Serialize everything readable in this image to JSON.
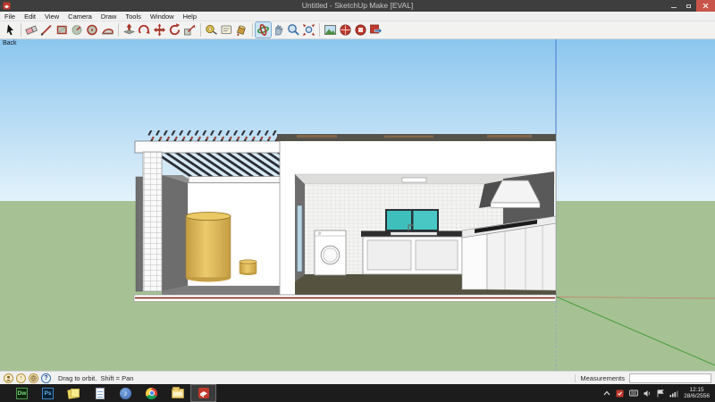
{
  "window": {
    "title": "Untitled - SketchUp Make [EVAL]"
  },
  "menu": {
    "items": [
      "File",
      "Edit",
      "View",
      "Camera",
      "Draw",
      "Tools",
      "Window",
      "Help"
    ]
  },
  "toolbar": {
    "tools": [
      {
        "name": "select"
      },
      {
        "name": "eraser"
      },
      {
        "name": "line"
      },
      {
        "name": "rectangle"
      },
      {
        "name": "circle"
      },
      {
        "name": "polygon"
      },
      {
        "name": "arc"
      },
      {
        "name": "push-pull"
      },
      {
        "name": "follow-me"
      },
      {
        "name": "move"
      },
      {
        "name": "rotate"
      },
      {
        "name": "scale"
      },
      {
        "name": "tape-measure"
      },
      {
        "name": "text"
      },
      {
        "name": "paint-bucket"
      },
      {
        "name": "orbit",
        "active": true
      },
      {
        "name": "pan"
      },
      {
        "name": "zoom"
      },
      {
        "name": "zoom-extents"
      },
      {
        "name": "get-models"
      },
      {
        "name": "share-model"
      },
      {
        "name": "share-component"
      },
      {
        "name": "send-to-layout"
      }
    ]
  },
  "viewport": {
    "scene_tab_label": "Back"
  },
  "statusbar": {
    "icons": [
      {
        "name": "credits-icon",
        "glyph": ""
      },
      {
        "name": "claim-credit-icon",
        "glyph": "↑"
      },
      {
        "name": "geolocation-icon",
        "glyph": ""
      },
      {
        "name": "help-icon",
        "glyph": "?"
      }
    ],
    "hint": "Drag to orbit.  Shift = Pan",
    "measurements_label": "Measurements",
    "measurements_value": ""
  },
  "taskbar": {
    "apps": [
      {
        "name": "dreamweaver",
        "label": "Dw"
      },
      {
        "name": "photoshop",
        "label": "Ps"
      },
      {
        "name": "sticky-notes",
        "label": ""
      },
      {
        "name": "notepad",
        "label": ""
      },
      {
        "name": "itunes",
        "label": "♪"
      },
      {
        "name": "chrome",
        "label": ""
      },
      {
        "name": "file-explorer",
        "label": ""
      },
      {
        "name": "sketchup",
        "label": "",
        "active": true
      }
    ],
    "tray": {
      "time": "12:15",
      "date": "28/6/2556"
    }
  },
  "scene": {
    "colors": {
      "sky_top": "#8CC6EE",
      "sky_horizon": "#E3F2FB",
      "ground": "#A6C294",
      "axis_blue": "#4A7BD0",
      "axis_green": "#4E9E43",
      "axis_red": "#C27A66",
      "section_line_red": "#7E2218",
      "tank_yellow": "#ECCB6C",
      "window_teal": "#3FBFBC",
      "floor_olive": "#555240",
      "interior_wall_gray": "#6D6D6D",
      "wall_white": "#FFFFFF"
    }
  }
}
